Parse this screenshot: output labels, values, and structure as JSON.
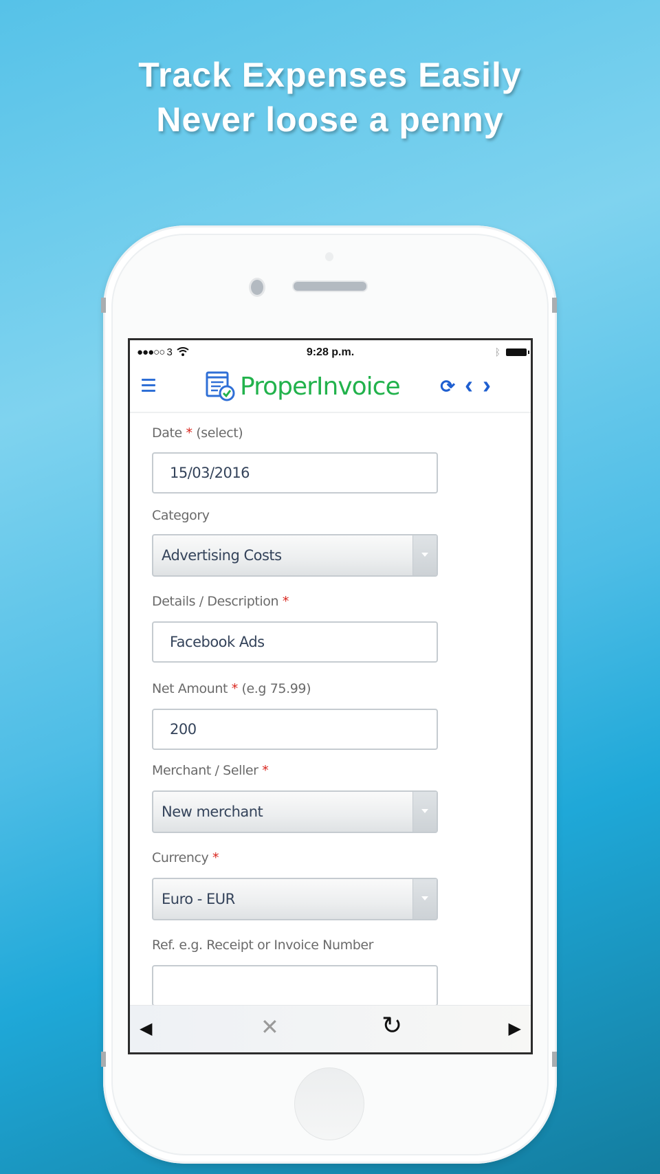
{
  "promo": {
    "headline_line1": "Track Expenses Easily",
    "headline_line2": "Never loose a penny"
  },
  "statusbar": {
    "signal": "●●●○○ 3",
    "wifi_icon": "wifi-icon",
    "time": "9:28 p.m.",
    "bluetooth_icon": "bluetooth-icon",
    "battery_icon": "battery-icon"
  },
  "navbar": {
    "menu_icon": "hamburger-menu-icon",
    "logo_text": "ProperInvoice",
    "refresh_icon": "⟳",
    "prev_icon": "‹",
    "next_icon": "›",
    "brand_color": "#22b24c",
    "accent_color": "#1f5fd0"
  },
  "form": {
    "date": {
      "label": "Date",
      "required": "*",
      "hint": "(select)",
      "value": "15/03/2016"
    },
    "category": {
      "label": "Category",
      "value": "Advertising Costs"
    },
    "details": {
      "label": "Details / Description",
      "required": "*",
      "value": "Facebook Ads"
    },
    "net_amount": {
      "label": "Net Amount",
      "required": "*",
      "hint": "(e.g 75.99)",
      "value": "200"
    },
    "merchant": {
      "label": "Merchant / Seller",
      "required": "*",
      "value": "New merchant"
    },
    "currency": {
      "label": "Currency",
      "required": "*",
      "value": "Euro - EUR"
    },
    "reference": {
      "label": "Ref. e.g. Receipt or Invoice Number",
      "value": ""
    }
  },
  "browserbar": {
    "back": "◀",
    "stop": "✕",
    "reload": "↻",
    "forward": "▶"
  }
}
